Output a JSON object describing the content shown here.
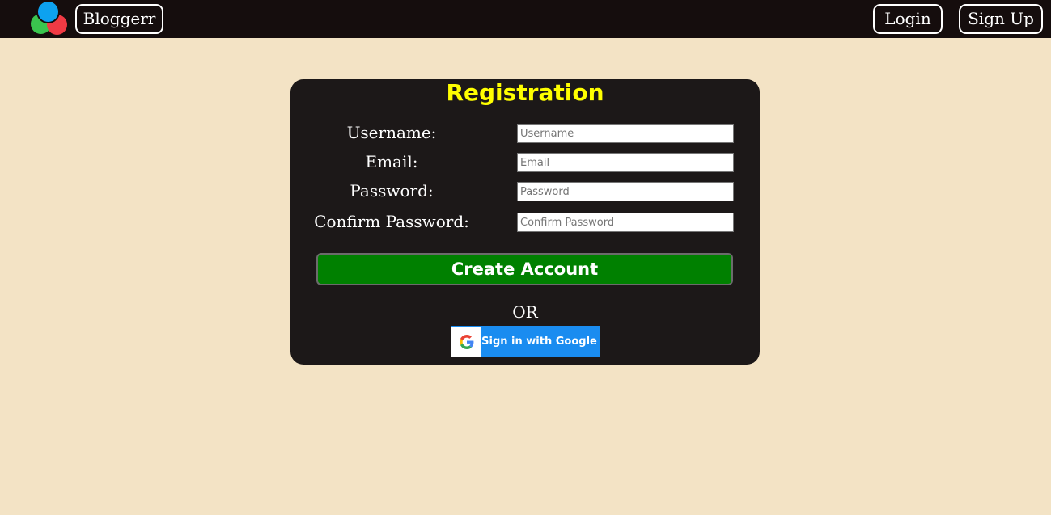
{
  "navbar": {
    "brand_label": "Bloggerr",
    "login_label": "Login",
    "signup_label": "Sign Up"
  },
  "form": {
    "title": "Registration",
    "fields": [
      {
        "label": "Username:",
        "placeholder": "Username"
      },
      {
        "label": "Email:",
        "placeholder": "Email"
      },
      {
        "label": "Password:",
        "placeholder": "Password"
      },
      {
        "label": "Confirm Password:",
        "placeholder": "Confirm Password"
      }
    ],
    "submit_label": "Create Account",
    "or_text": "OR",
    "google_label": "Sign in with Google"
  },
  "icons": {
    "logo": "three-circles-logo-icon",
    "google": "google-g-icon"
  },
  "colors": {
    "page_background": "#f3e3c5",
    "navbar_background": "#150d0d",
    "card_background": "#1c1818",
    "title": "#ffff00",
    "submit_button": "#008000",
    "google_button": "#1a8cf0"
  }
}
